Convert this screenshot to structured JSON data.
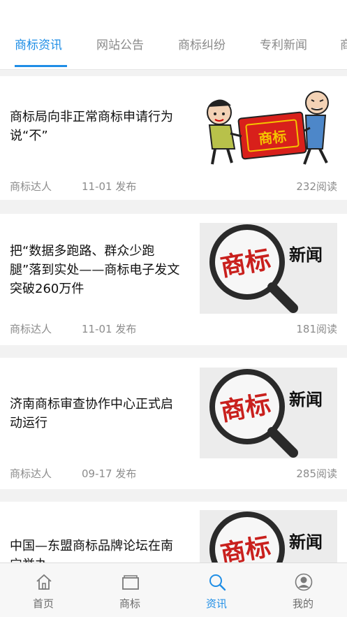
{
  "tabs": [
    "商标资讯",
    "网站公告",
    "商标纠纷",
    "专利新闻",
    "商"
  ],
  "articles": [
    {
      "title": "商标局向非正常商标申请行为说“不”",
      "author": "商标达人",
      "date": "11-01 发布",
      "reads": "232阅读",
      "image_text": "商标"
    },
    {
      "title": "把“数据多跑路、群众少跑腿”落到实处——商标电子发文突破260万件",
      "author": "商标达人",
      "date": "11-01 发布",
      "reads": "181阅读",
      "image_text_a": "商标",
      "image_text_b": "新闻"
    },
    {
      "title": "济南商标审查协作中心正式启动运行",
      "author": "商标达人",
      "date": "09-17 发布",
      "reads": "285阅读",
      "image_text_a": "商标",
      "image_text_b": "新闻"
    },
    {
      "title": "中国—东盟商标品牌论坛在南宁举办",
      "image_text_a": "商标",
      "image_text_b": "新闻"
    }
  ],
  "nav": [
    {
      "label": "首页",
      "icon": "home-icon"
    },
    {
      "label": "商标",
      "icon": "folder-icon"
    },
    {
      "label": "资讯",
      "icon": "search-icon"
    },
    {
      "label": "我的",
      "icon": "user-icon"
    }
  ],
  "colors": {
    "accent": "#1f8ee6",
    "background": "#f2f2f2"
  }
}
